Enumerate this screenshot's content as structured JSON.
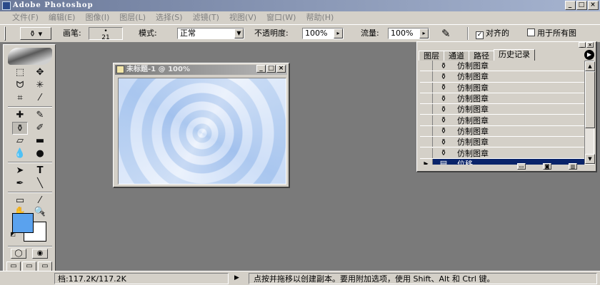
{
  "window": {
    "title": "Adobe Photoshop"
  },
  "menu": [
    "文件(F)",
    "编辑(E)",
    "图像(I)",
    "图层(L)",
    "选择(S)",
    "滤镜(T)",
    "视图(V)",
    "窗口(W)",
    "帮助(H)"
  ],
  "options": {
    "brush_label": "画笔:",
    "brush_size": "21",
    "mode_label": "模式:",
    "mode_value": "正常",
    "opacity_label": "不透明度:",
    "opacity_value": "100%",
    "flow_label": "流量:",
    "flow_value": "100%",
    "aligned_label": "对齐的",
    "use_all_layers_label": "用于所有图"
  },
  "document": {
    "title": "未标题-1 @ 100%"
  },
  "palette": {
    "tabs": [
      "图层",
      "通道",
      "路径",
      "历史记录"
    ],
    "active_tab": "历史记录",
    "history": [
      {
        "label": "仿制图章",
        "icon": "stamp-icon"
      },
      {
        "label": "仿制图章",
        "icon": "stamp-icon"
      },
      {
        "label": "仿制图章",
        "icon": "stamp-icon"
      },
      {
        "label": "仿制图章",
        "icon": "stamp-icon"
      },
      {
        "label": "仿制图章",
        "icon": "stamp-icon"
      },
      {
        "label": "仿制图章",
        "icon": "stamp-icon"
      },
      {
        "label": "仿制图章",
        "icon": "stamp-icon"
      },
      {
        "label": "仿制图章",
        "icon": "stamp-icon"
      },
      {
        "label": "仿制图章",
        "icon": "stamp-icon"
      },
      {
        "label": "位移",
        "icon": "offset-icon",
        "active": true
      }
    ]
  },
  "colors": {
    "foreground": "#5aa2ee",
    "background": "#ffffff",
    "selection": "#0a246a"
  },
  "status": {
    "doc_size": "档:117.2K/117.2K",
    "hint": "点按并拖移以创建副本。要用附加选项，使用 Shift、Alt 和 Ctrl 键。"
  }
}
